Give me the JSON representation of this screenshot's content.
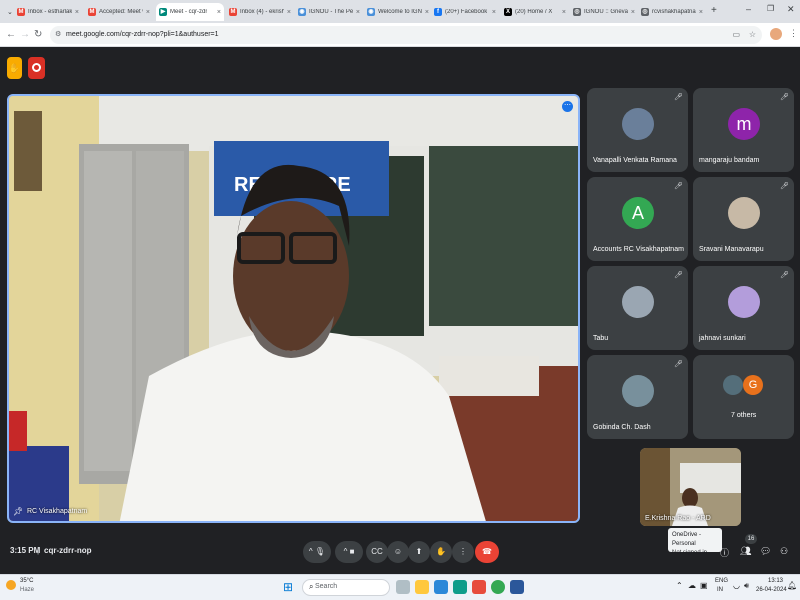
{
  "browser": {
    "tabs": [
      {
        "label": "Inbox - estharlakt",
        "icon": "gmail-icon",
        "color": "#ea4335",
        "glyph": "M"
      },
      {
        "label": "Accepted: Meet ww",
        "icon": "gmail-icon",
        "color": "#ea4335",
        "glyph": "M"
      },
      {
        "label": "Meet - cqr-zdr",
        "icon": "meet-icon",
        "color": "#00897b",
        "glyph": "▶",
        "active": true
      },
      {
        "label": "Inbox (4) - ekrishn",
        "icon": "gmail-icon",
        "color": "#ea4335",
        "glyph": "M"
      },
      {
        "label": "IGNOU - The Peo",
        "icon": "ignou-icon",
        "color": "#4a90d9",
        "glyph": "◉"
      },
      {
        "label": "Welcome to IGNO",
        "icon": "ignou-icon",
        "color": "#4a90d9",
        "glyph": "◉"
      },
      {
        "label": "(20+) Facebook",
        "icon": "facebook-icon",
        "color": "#1877f2",
        "glyph": "f"
      },
      {
        "label": "(20) Home / X",
        "icon": "x-icon",
        "color": "#000000",
        "glyph": "X"
      },
      {
        "label": "IGNOU :: Grievan",
        "icon": "globe-icon",
        "color": "#5f6368",
        "glyph": "◎"
      },
      {
        "label": "rcvishakhapatnam",
        "icon": "globe-icon",
        "color": "#5f6368",
        "glyph": "◎"
      }
    ],
    "new_tab": "+",
    "url": "meet.google.com/cqr-zdrr-nop?pli=1&authuser=1"
  },
  "meet": {
    "main_speaker": "RC Visakhapatnam",
    "participants": [
      {
        "name": "Vanapalli Venkata Ramana",
        "type": "photo",
        "color": "#6a7f9a"
      },
      {
        "name": "mangaraju bandam",
        "type": "letter",
        "letter": "m",
        "color": "#8e24aa"
      },
      {
        "name": "Accounts RC Visakhapatnam",
        "type": "letter",
        "letter": "A",
        "color": "#33a853"
      },
      {
        "name": "Sravani Manavarapu",
        "type": "photo",
        "color": "#c7b9a6"
      },
      {
        "name": "Tabu",
        "type": "photo",
        "color": "#9aa6b2"
      },
      {
        "name": "jahnavi sunkari",
        "type": "photo",
        "color": "#b39ddb"
      },
      {
        "name": "Gobinda Ch. Dash",
        "type": "photo",
        "color": "#78909c"
      }
    ],
    "others": {
      "label": "7 others",
      "letter": "G",
      "color": "#e8711c"
    },
    "self_view_name": "E.Krishna Rao - ARD",
    "time": "3:15 PM",
    "meeting_code": "cqr-zdrr-nop",
    "participant_count": "16",
    "onedrive_tooltip": {
      "line1": "OneDrive - Personal",
      "line2": "Not signed in"
    }
  },
  "taskbar": {
    "weather_temp": "35°C",
    "weather_text": "Haze",
    "search_placeholder": "Search",
    "lang": "ENG",
    "region": "IN",
    "clock_time": "13:13",
    "clock_date": "26-04-2024"
  },
  "colors": {
    "accent": "#8ab4f8",
    "end_call": "#ea4335"
  }
}
